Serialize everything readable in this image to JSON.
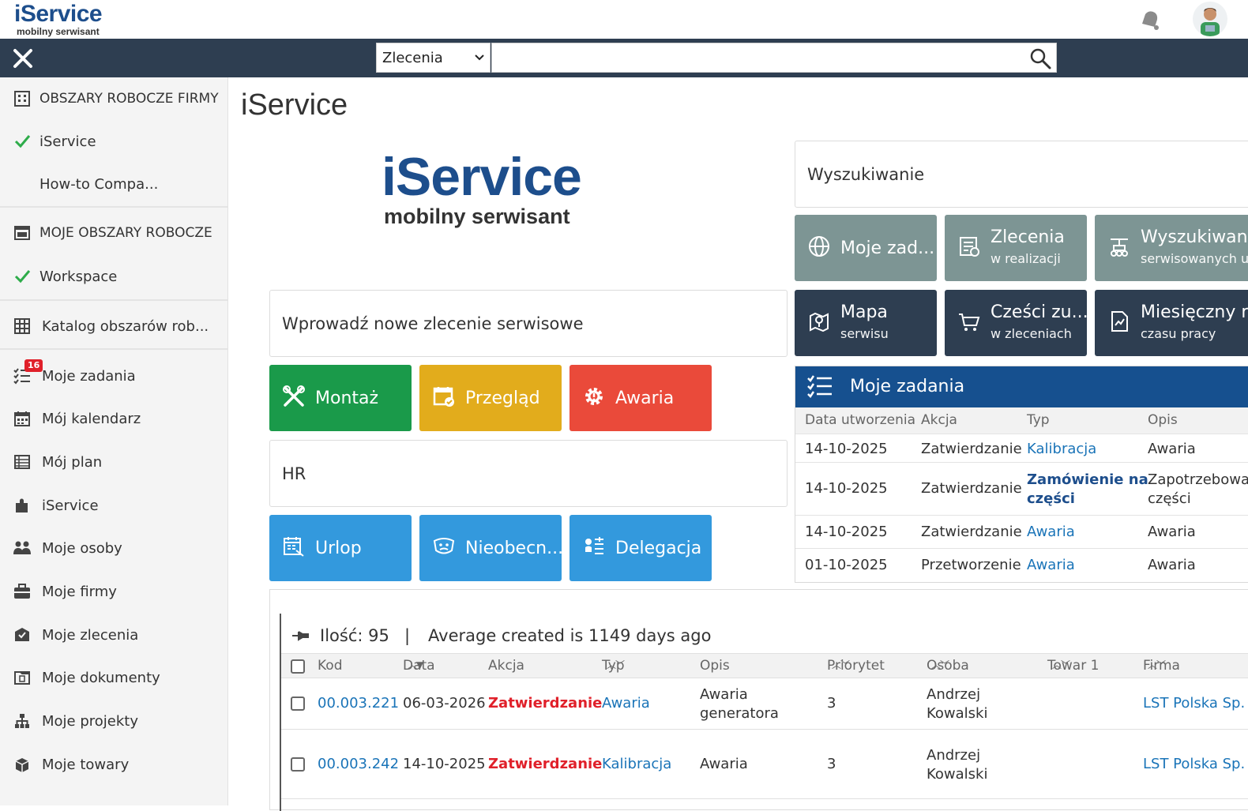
{
  "app": {
    "logo_name": "iService",
    "logo_tagline": "mobilny serwisant"
  },
  "search": {
    "scope": "Zlecenia",
    "placeholder": ""
  },
  "sidebar": {
    "sections": [
      {
        "label": "OBSZARY ROBOCZE FIRMY"
      },
      {
        "label": "iService",
        "checked": true
      },
      {
        "label": "How-to Compa..."
      },
      {
        "label": "MOJE OBSZARY ROBOCZE"
      },
      {
        "label": "Workspace",
        "checked": true
      },
      {
        "label": "Katalog obszarów rob..."
      }
    ],
    "items": [
      {
        "label": "Moje zadania",
        "badge": "16",
        "icon": "tasks-icon"
      },
      {
        "label": "Mój kalendarz",
        "icon": "calendar-icon"
      },
      {
        "label": "Mój plan",
        "icon": "plan-icon"
      },
      {
        "label": "iService",
        "icon": "puzzle-icon"
      },
      {
        "label": "Moje osoby",
        "icon": "people-icon"
      },
      {
        "label": "Moje firmy",
        "icon": "briefcase-icon"
      },
      {
        "label": "Moje zlecenia",
        "icon": "orders-icon"
      },
      {
        "label": "Moje dokumenty",
        "icon": "documents-icon"
      },
      {
        "label": "Moje projekty",
        "icon": "projects-icon"
      },
      {
        "label": "Moje towary",
        "icon": "goods-icon"
      }
    ]
  },
  "main": {
    "title": "iService",
    "new_order_label": "Wprowadź nowe zlecenie serwisowe",
    "order_buttons": [
      {
        "label": "Montaż",
        "color": "#1a9a4a",
        "icon": "tools-icon"
      },
      {
        "label": "Przegląd",
        "color": "#e2ac1c",
        "icon": "calendar-check-icon"
      },
      {
        "label": "Awaria",
        "color": "#ea4a3a",
        "icon": "gear-alert-icon"
      }
    ],
    "hr_label": "HR",
    "hr_buttons": [
      {
        "label": "Urlop",
        "color": "#3399dd",
        "icon": "vacation-icon"
      },
      {
        "label": "Nieobecn...",
        "color": "#3399dd",
        "icon": "absence-icon"
      },
      {
        "label": "Delegacja",
        "color": "#3399dd",
        "icon": "delegation-icon"
      }
    ],
    "search_label": "Wyszukiwanie",
    "search_tiles": [
      {
        "label": "Moje zad...",
        "sub": "",
        "color": "#7d9594"
      },
      {
        "label": "Zlecenia",
        "sub": "w realizacji",
        "color": "#7d9594"
      },
      {
        "label": "Wyszukiwan",
        "sub": "serwisowanych u",
        "color": "#7d9594"
      },
      {
        "label": "Mapa",
        "sub": "serwisu",
        "color": "#2e3e51"
      },
      {
        "label": "Cześci zu...",
        "sub": "w zleceniach",
        "color": "#2e3e51"
      },
      {
        "label": "Miesięczny r",
        "sub": "czasu pracy",
        "color": "#2e3e51"
      }
    ],
    "tasks_panel": {
      "title": "Moje zadania",
      "columns": [
        "Data utworzenia",
        "Akcja",
        "Typ",
        "Opis"
      ],
      "rows": [
        {
          "date": "14-10-2025",
          "action": "Zatwierdzanie",
          "type": "Kalibracja",
          "desc": "Awaria"
        },
        {
          "date": "14-10-2025",
          "action": "Zatwierdzanie",
          "type": "Zamówienie na części",
          "type_l1": "Zamówienie na",
          "type_l2": "części",
          "desc_l1": "Zapotrzebowa",
          "desc_l2": "części"
        },
        {
          "date": "14-10-2025",
          "action": "Zatwierdzanie",
          "type": "Awaria",
          "desc": "Awaria"
        },
        {
          "date": "01-10-2025",
          "action": "Przetworzenie",
          "type": "Awaria",
          "desc": "Awaria"
        }
      ]
    },
    "orders_table": {
      "count_label": "Ilość: 95",
      "separator": "|",
      "avg_label": "Average created is 1149 days ago",
      "columns": [
        "Kod",
        "Data",
        "Akcja",
        "Typ",
        "Opis",
        "Priorytet",
        "Osoba",
        "Towar 1",
        "Firma"
      ],
      "rows": [
        {
          "code": "00.003.221",
          "date": "06-03-2026",
          "action": "Zatwierdzanie",
          "type": "Awaria",
          "desc_l1": "Awaria",
          "desc_l2": "generatora",
          "priority": "3",
          "person_l1": "Andrzej",
          "person_l2": "Kowalski",
          "goods": "",
          "company": "LST Polska Sp."
        },
        {
          "code": "00.003.242",
          "date": "14-10-2025",
          "action": "Zatwierdzanie",
          "type": "Kalibracja",
          "desc_l1": "Awaria",
          "desc_l2": "",
          "priority": "3",
          "person_l1": "Andrzej",
          "person_l2": "Kowalski",
          "goods": "",
          "company": "LST Polska Sp."
        }
      ]
    }
  }
}
